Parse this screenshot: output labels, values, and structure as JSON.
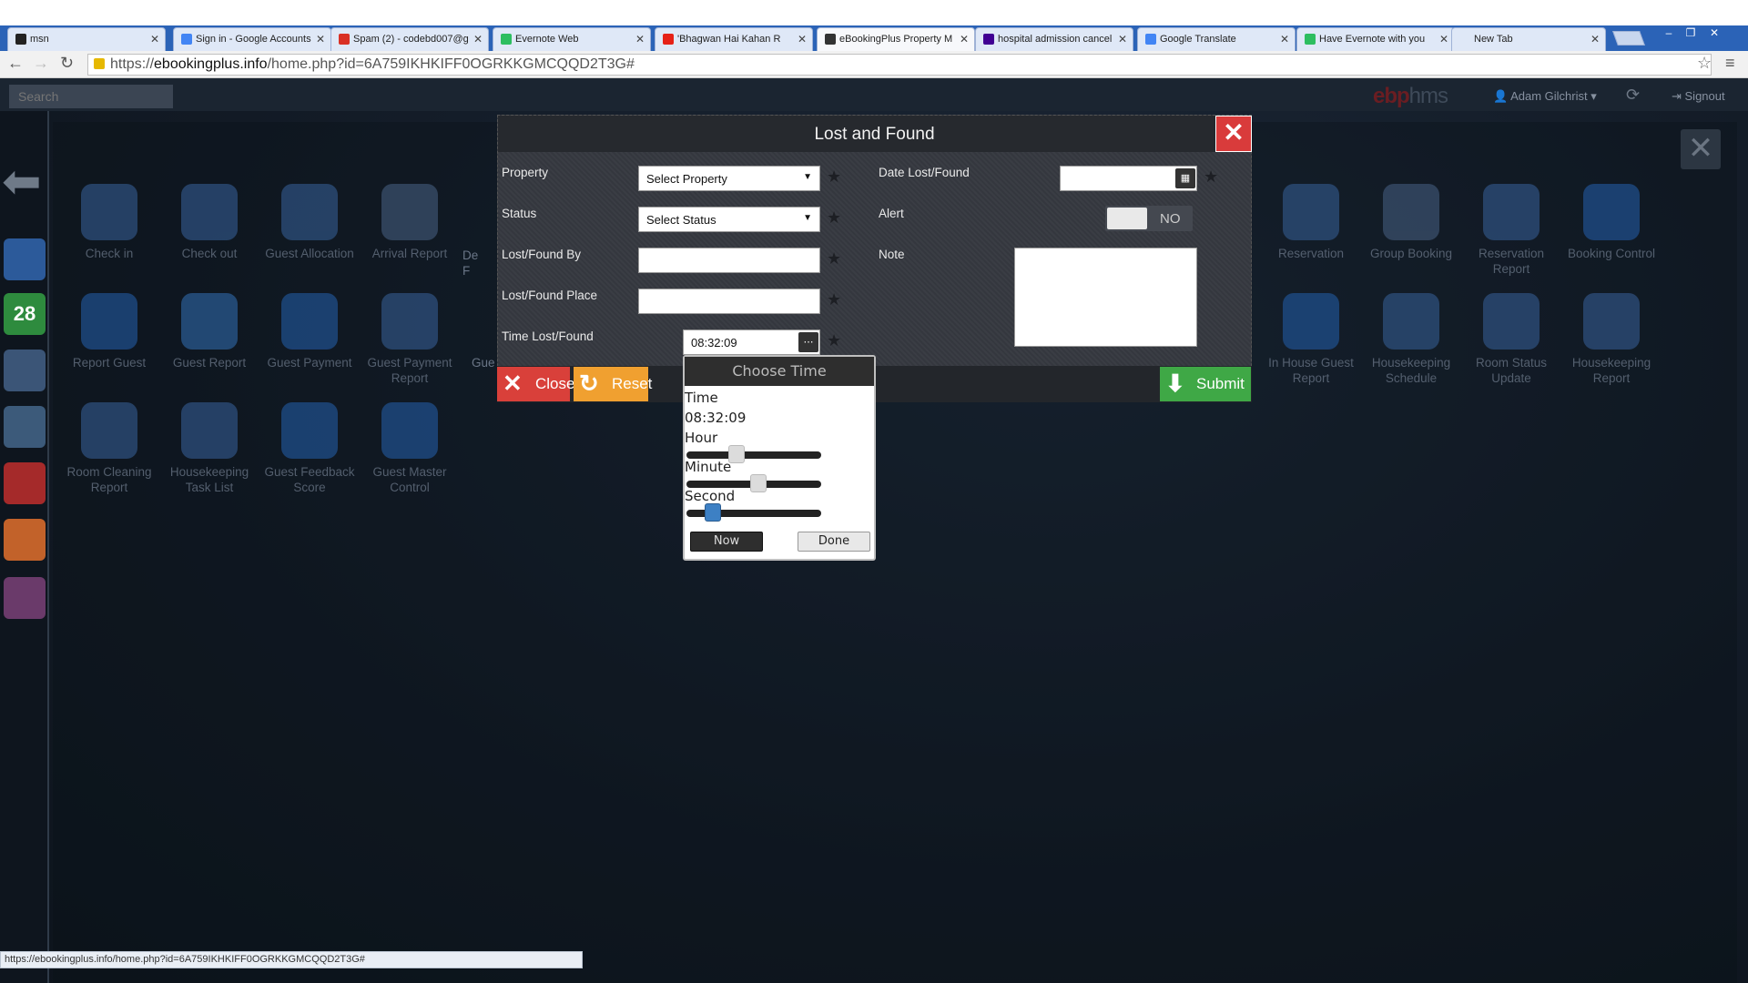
{
  "browser": {
    "tabs": [
      {
        "title": "msn",
        "favicon_color": "#222222"
      },
      {
        "title": "Sign in - Google Accounts",
        "favicon_color": "#4285f4"
      },
      {
        "title": "Spam (2) - codebd007@g",
        "favicon_color": "#d93025"
      },
      {
        "title": "Evernote Web",
        "favicon_color": "#2dbe60"
      },
      {
        "title": "'Bhagwan Hai Kahan R",
        "favicon_color": "#e62117"
      },
      {
        "title": "eBookingPlus Property M",
        "favicon_color": "#333333",
        "active": true
      },
      {
        "title": "hospital admission cancel",
        "favicon_color": "#410093"
      },
      {
        "title": "Google Translate",
        "favicon_color": "#4285f4"
      },
      {
        "title": "Have Evernote with you",
        "favicon_color": "#2dbe60"
      },
      {
        "title": "New Tab",
        "favicon_color": ""
      }
    ],
    "url_scheme": "https://",
    "url_host": "ebookingplus.info",
    "url_path": "/home.php?id=6A759IKHKIFF0OGRKKGMCQQD2T3G#",
    "status_url": "https://ebookingplus.info/home.php?id=6A759IKHKIFF0OGRKKGMCQQD2T3G#"
  },
  "app": {
    "search_placeholder": "Search",
    "logo_main": "ebp",
    "logo_sub": "hms",
    "user": "Adam Gilchrist",
    "signout": "Signout",
    "calendar_day": "28",
    "tiles": [
      {
        "label": "Check in",
        "color": "#2d4f7c"
      },
      {
        "label": "Check out",
        "color": "#2d4f7c"
      },
      {
        "label": "Guest Allocation",
        "color": "#2d4f7c"
      },
      {
        "label": "Arrival Report",
        "color": "#3a4f6c"
      },
      {
        "label": "Report Guest",
        "color": "#1f4d8a"
      },
      {
        "label": "Guest Report",
        "color": "#2a5a8f"
      },
      {
        "label": "Guest Payment",
        "color": "#1f4d8a"
      },
      {
        "label": "Guest Payment Report",
        "color": "#2d4f7c"
      },
      {
        "label": "Room Cleaning Report",
        "color": "#2d4f7c"
      },
      {
        "label": "Housekeeping Task List",
        "color": "#2d4f7c"
      },
      {
        "label": "Guest Feedback Score",
        "color": "#1f4d8a"
      },
      {
        "label": "Guest Master Control",
        "color": "#1f4d8a"
      },
      {
        "label": "Reservation",
        "color": "#2d4f7c"
      },
      {
        "label": "Group Booking",
        "color": "#3a4f6c"
      },
      {
        "label": "Reservation Report",
        "color": "#2d4f7c"
      },
      {
        "label": "Booking Control",
        "color": "#1f4d8a"
      },
      {
        "label": "In House Guest Report",
        "color": "#1f4d8a"
      },
      {
        "label": "Housekeeping Schedule",
        "color": "#2d4f7c"
      },
      {
        "label": "Room Status Update",
        "color": "#2d4f7c"
      },
      {
        "label": "Housekeeping Report",
        "color": "#2d4f7c"
      }
    ],
    "partial_labels": [
      "De",
      "F",
      "Gue"
    ]
  },
  "modal": {
    "title": "Lost and Found",
    "property_label": "Property",
    "property_value": "Select Property",
    "status_label": "Status",
    "status_value": "Select Status",
    "lostby_label": "Lost/Found By",
    "lostby_value": "",
    "place_label": "Lost/Found Place",
    "place_value": "",
    "time_label": "Time Lost/Found",
    "time_value": "08:32:09",
    "date_label": "Date Lost/Found",
    "date_value": "",
    "alert_label": "Alert",
    "alert_value": "NO",
    "note_label": "Note",
    "close_label": "Close",
    "reset_label": "Reset",
    "submit_label": "Submit"
  },
  "timepicker": {
    "header": "Choose Time",
    "time_label": "Time",
    "time_value": "08:32:09",
    "hour_label": "Hour",
    "minute_label": "Minute",
    "second_label": "Second",
    "hour_fraction": 0.35,
    "minute_fraction": 0.54,
    "second_fraction": 0.15,
    "now_label": "Now",
    "done_label": "Done"
  }
}
